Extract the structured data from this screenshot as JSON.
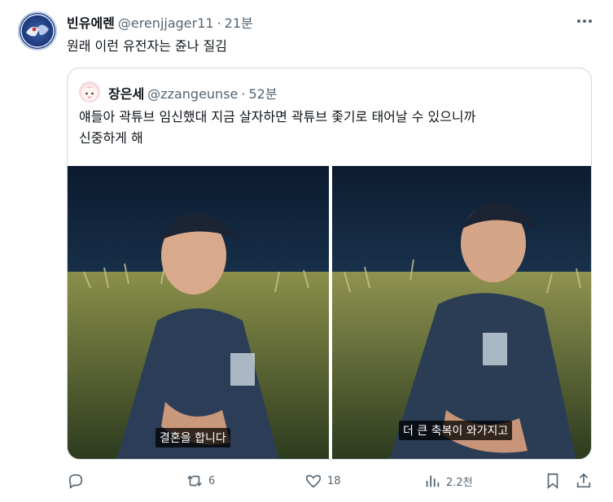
{
  "tweet": {
    "author_name": "빈유에렌",
    "handle": "@erenjjager11",
    "separator": "·",
    "time": "21분",
    "text": "원래 이런 유전자는 쥰나 질김"
  },
  "quote": {
    "author_name": "장은세",
    "handle": "@zzangeunse",
    "separator": "·",
    "time": "52분",
    "text_line1": "얘들아 곽튜브 임신했대 지금 살자하면 곽튜브 좇기로 태어날 수 있으니까",
    "text_line2": "신중하게 해",
    "media": [
      {
        "caption": "결혼을 합니다"
      },
      {
        "caption": "더 큰 축복이 와가지고"
      }
    ]
  },
  "actions": {
    "reply_count": "",
    "retweet_count": "6",
    "like_count": "18",
    "views_count": "2.2천"
  },
  "icons": {
    "more": "more-horizontal-icon",
    "reply": "reply-icon",
    "retweet": "retweet-icon",
    "like": "heart-icon",
    "views": "views-icon",
    "bookmark": "bookmark-icon",
    "share": "share-icon"
  },
  "colors": {
    "text": "#0f1419",
    "secondary": "#536471",
    "border": "#cfd9de"
  }
}
